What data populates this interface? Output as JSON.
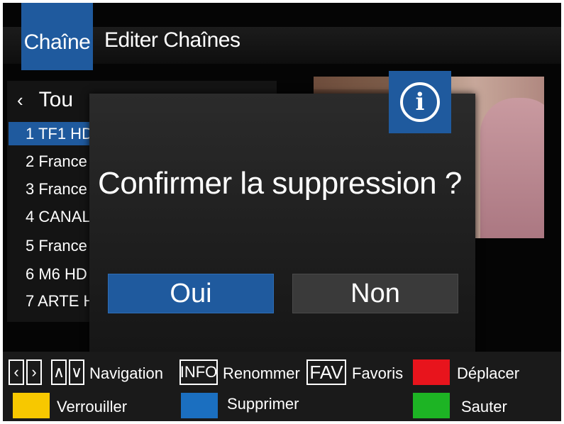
{
  "header": {
    "tab_active": "Chaîne",
    "tab_edit": "Editer Chaînes"
  },
  "list": {
    "group_chevron": "‹",
    "group_label": "Tou",
    "channels": [
      "1 TF1 HD",
      "2 France",
      "3 France",
      "4 CANAL",
      "5 France",
      "6 M6 HD",
      "7 ARTE H"
    ]
  },
  "dialog": {
    "icon": "info-icon",
    "message": "Confirmer la suppression ?",
    "yes_label": "Oui",
    "no_label": "Non"
  },
  "footer": {
    "nav_keys": [
      "‹",
      "›",
      "∧",
      "∨"
    ],
    "navigation": "Navigation",
    "info_key": "INFO",
    "rename": "Renommer",
    "fav_key": "FAV",
    "favorites": "Favoris",
    "move": "Déplacer",
    "lock": "Verrouiller",
    "delete": "Supprimer",
    "skip": "Sauter"
  },
  "colors": {
    "accent": "#1f5a9e",
    "red": "#e8141c",
    "green": "#1db424",
    "yellow": "#f7c800",
    "blue": "#1b6fc0"
  }
}
